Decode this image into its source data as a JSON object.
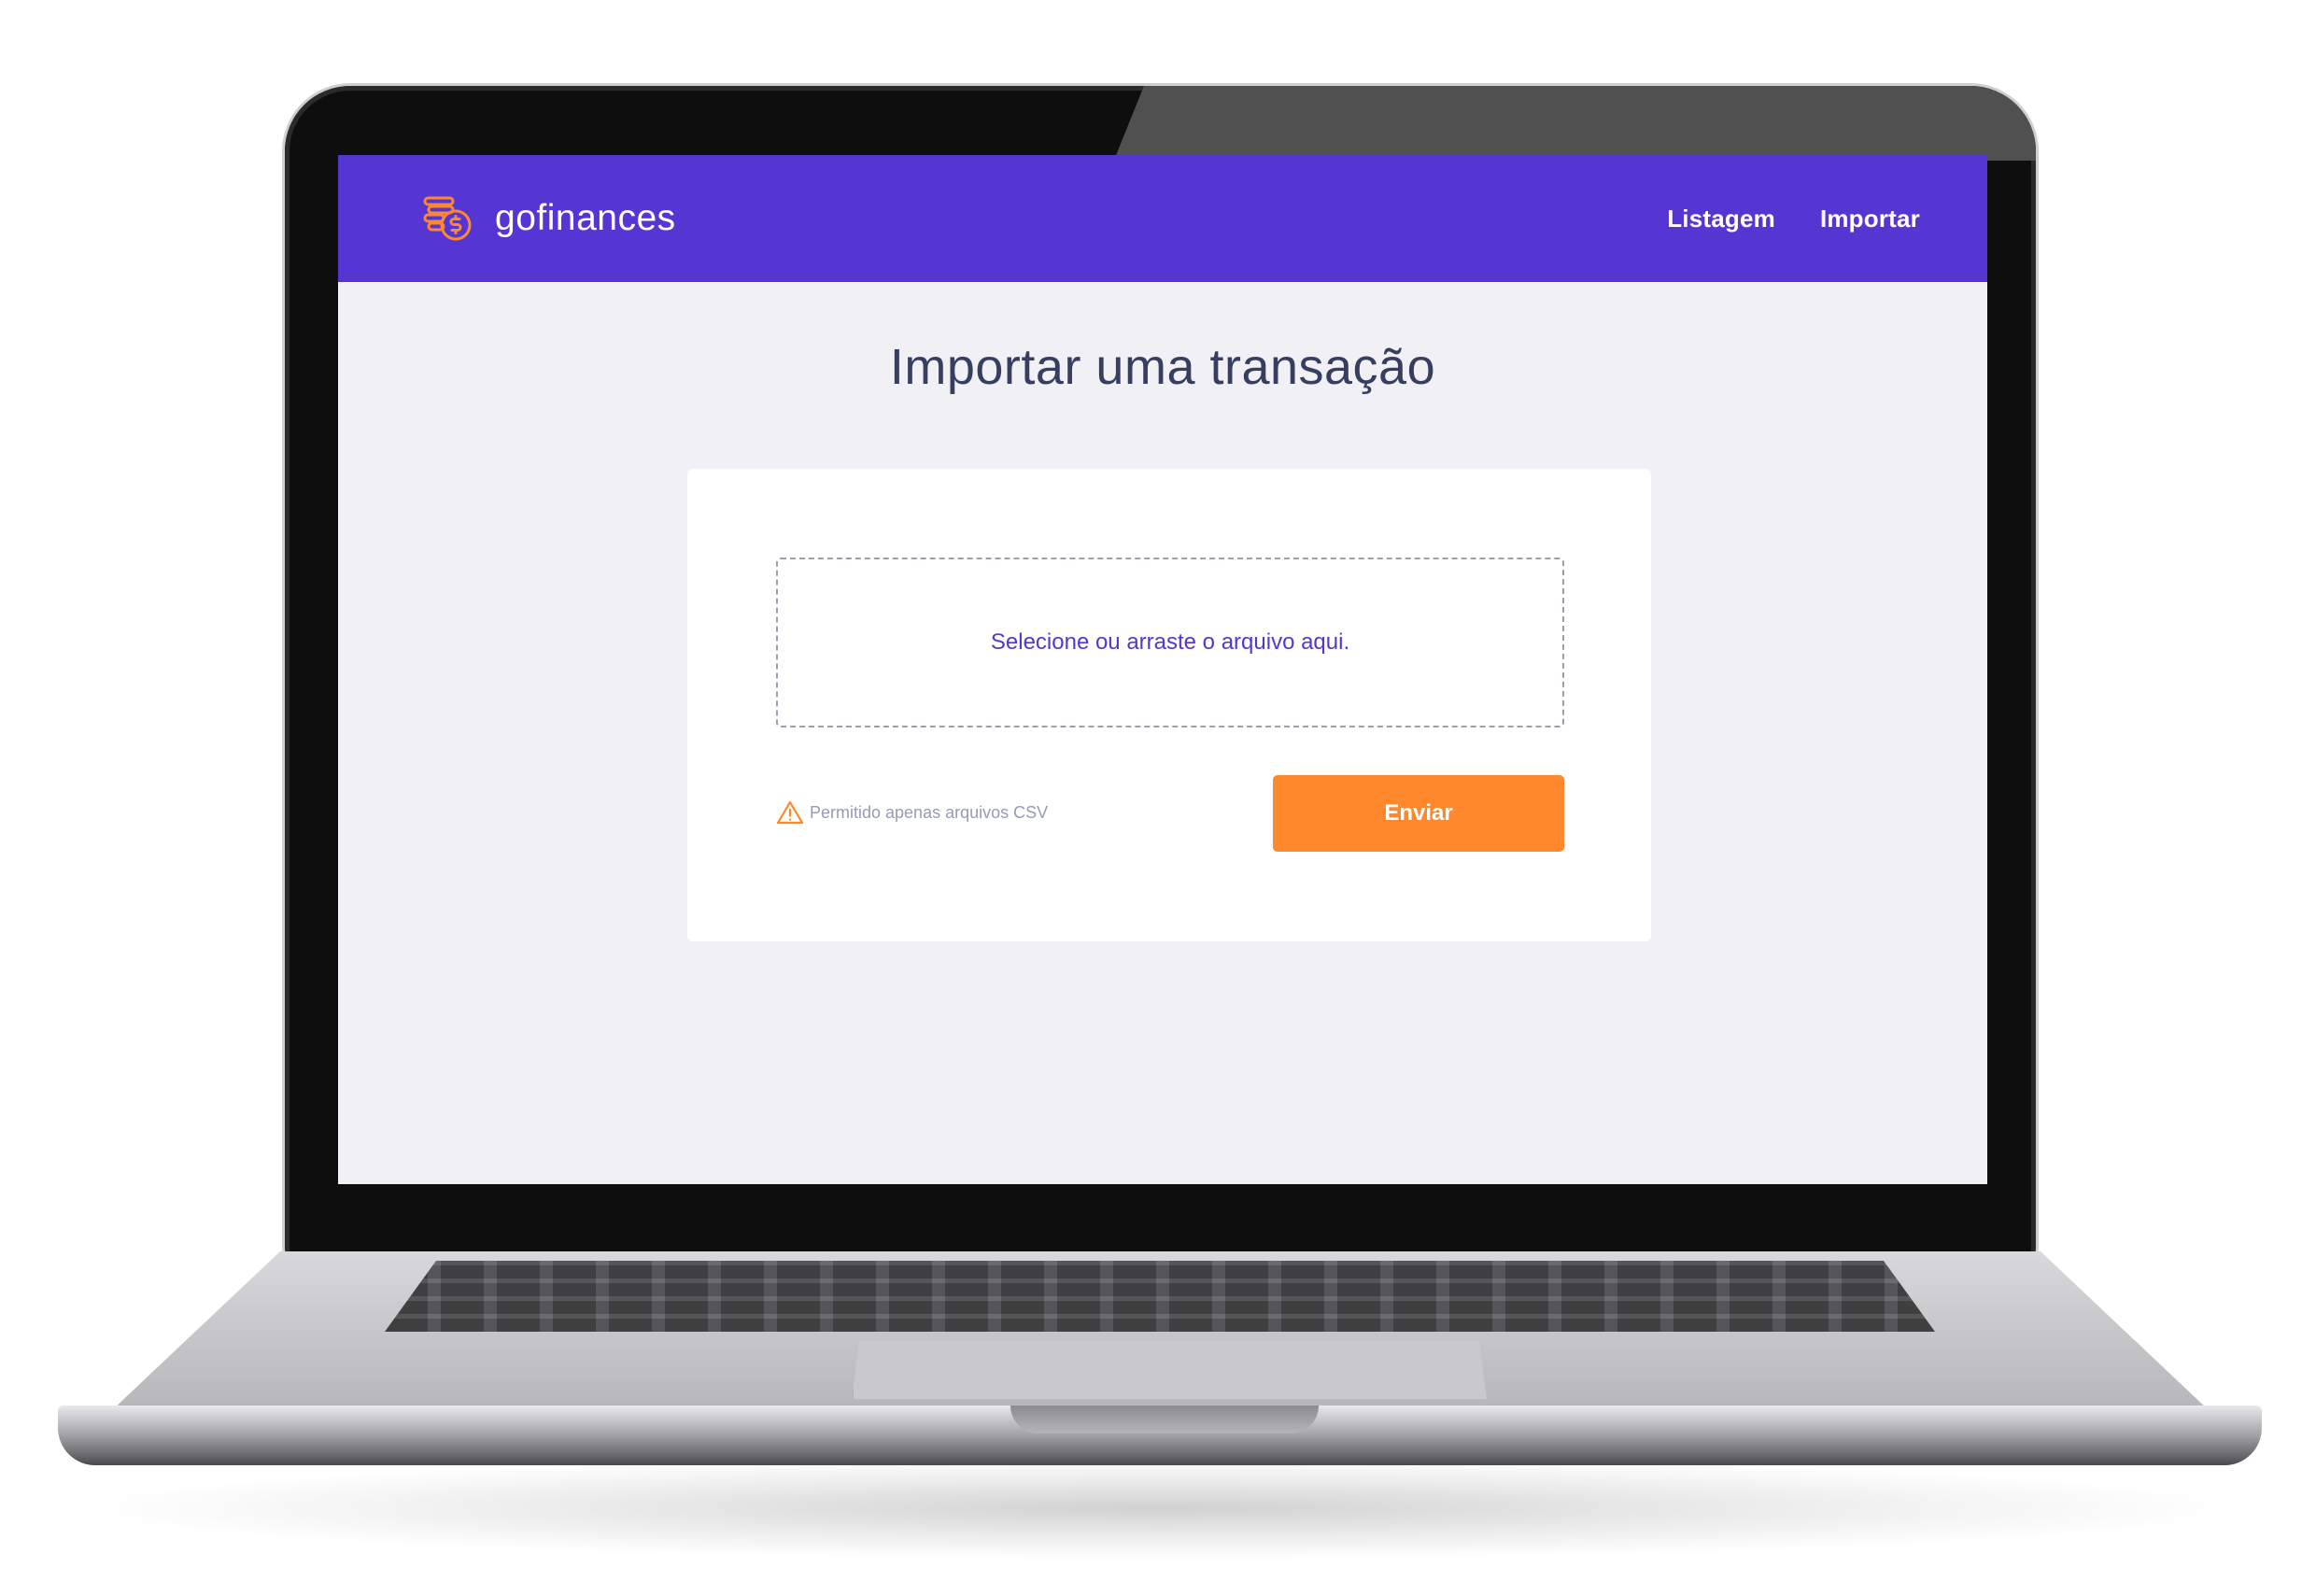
{
  "header": {
    "brand_name": "gofinances",
    "brand_icon": "coins-dollar-icon",
    "nav_items": [
      {
        "label": "Listagem"
      },
      {
        "label": "Importar"
      }
    ]
  },
  "main": {
    "title": "Importar uma transação",
    "dropzone": {
      "text": "Selecione ou arraste o arquivo aqui."
    },
    "hint": {
      "icon": "alert-triangle-icon",
      "text": "Permitido apenas arquivos CSV"
    },
    "submit_label": "Enviar"
  },
  "colors": {
    "primary": "#5636d3",
    "accent": "#ff872c",
    "title": "#363f5f",
    "hint": "#969cb3",
    "background": "#f0f0f5"
  }
}
